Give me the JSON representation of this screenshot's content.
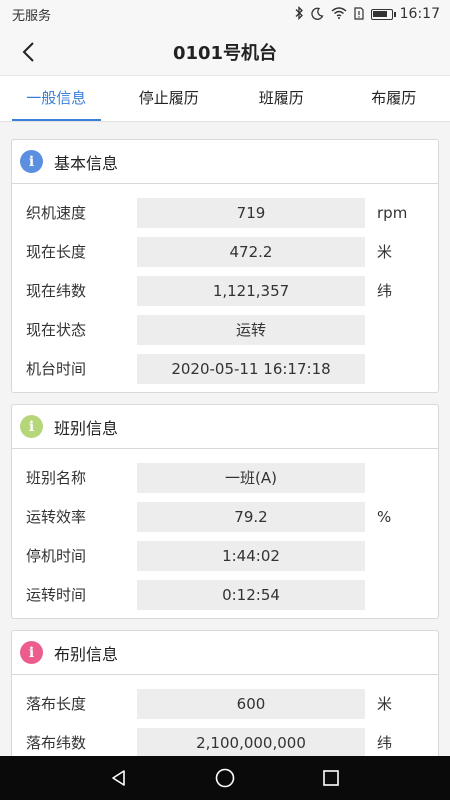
{
  "status_bar": {
    "carrier": "无服务",
    "time": "16:17",
    "battery_level": 0.85
  },
  "nav": {
    "title": "0101号机台"
  },
  "tabs": [
    {
      "label": "一般信息",
      "active": true
    },
    {
      "label": "停止履历",
      "active": false
    },
    {
      "label": "班履历",
      "active": false
    },
    {
      "label": "布履历",
      "active": false
    }
  ],
  "cards": [
    {
      "title": "基本信息",
      "icon": "i",
      "icon_color": "#5b8fe0",
      "rows": [
        {
          "label": "织机速度",
          "value": "719",
          "unit": "rpm"
        },
        {
          "label": "现在长度",
          "value": "472.2",
          "unit": "米"
        },
        {
          "label": "现在纬数",
          "value": "1,121,357",
          "unit": "纬"
        },
        {
          "label": "现在状态",
          "value": "运转",
          "unit": ""
        },
        {
          "label": "机台时间",
          "value": "2020-05-11 16:17:18",
          "unit": ""
        }
      ]
    },
    {
      "title": "班别信息",
      "icon": "i",
      "icon_color": "#b5d77a",
      "rows": [
        {
          "label": "班别名称",
          "value": "一班(A)",
          "unit": ""
        },
        {
          "label": "运转效率",
          "value": "79.2",
          "unit": "%"
        },
        {
          "label": "停机时间",
          "value": "1:44:02",
          "unit": ""
        },
        {
          "label": "运转时间",
          "value": "0:12:54",
          "unit": ""
        }
      ]
    },
    {
      "title": "布别信息",
      "icon": "i",
      "icon_color": "#ec5d8c",
      "rows": [
        {
          "label": "落布长度",
          "value": "600",
          "unit": "米"
        },
        {
          "label": "落布纬数",
          "value": "2,100,000,000",
          "unit": "纬"
        }
      ]
    }
  ]
}
